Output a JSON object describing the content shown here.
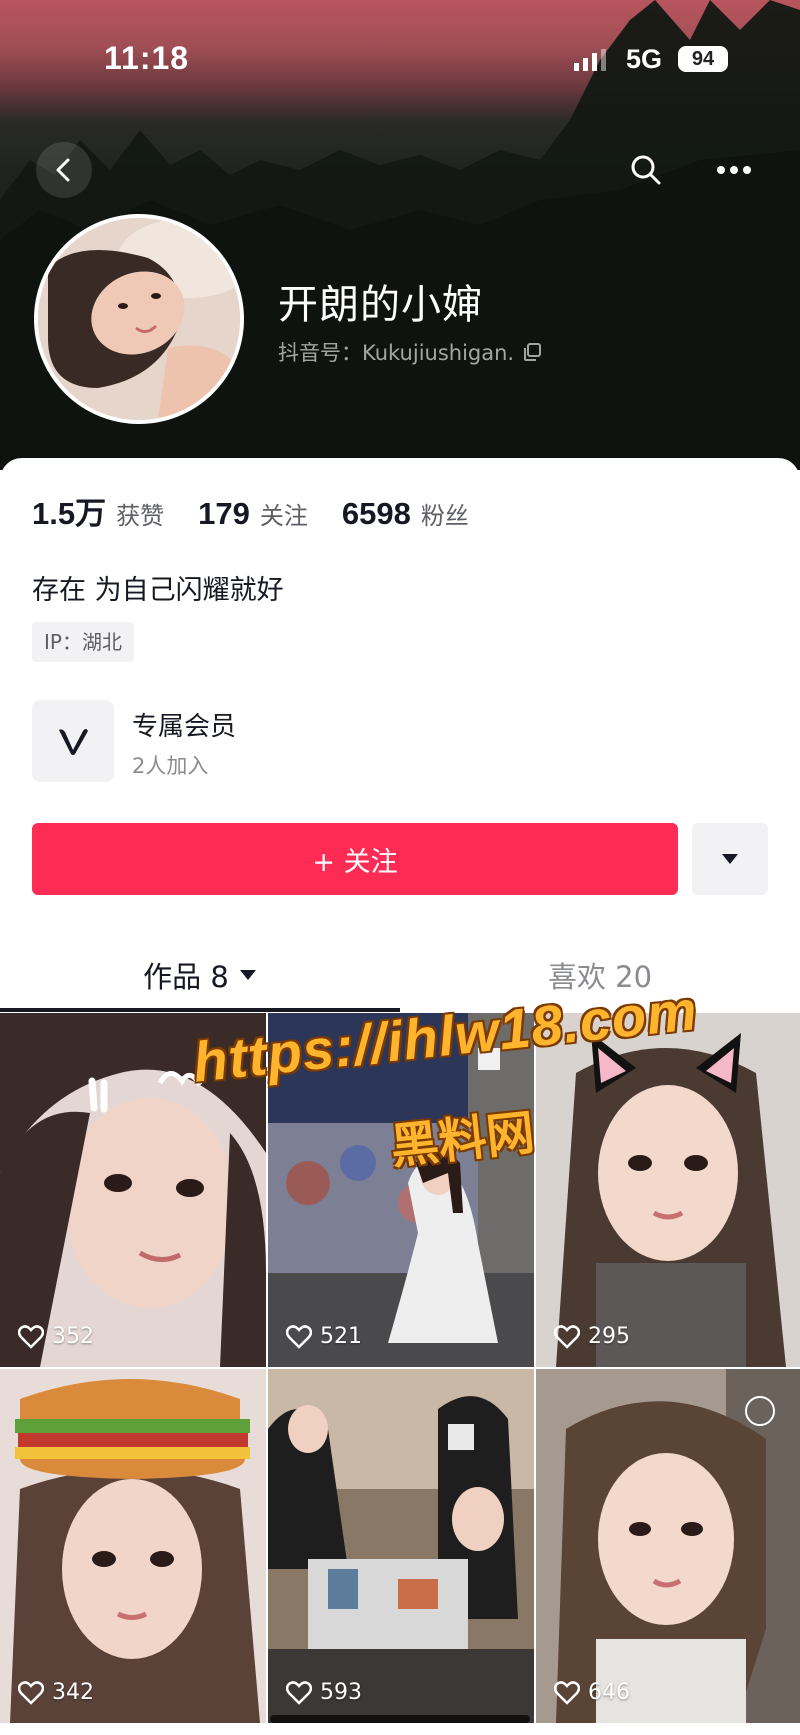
{
  "status_bar": {
    "time": "11:18",
    "network": "5G",
    "battery": "94"
  },
  "profile": {
    "nickname": "开朗的小婶",
    "douyin_id": "抖音号：Kukujiushigan.",
    "bio": "存在 为自己闪耀就好",
    "ip": "IP：湖北"
  },
  "stats": [
    {
      "value": "1.5万",
      "label": "获赞"
    },
    {
      "value": "179",
      "label": "关注"
    },
    {
      "value": "6598",
      "label": "粉丝"
    }
  ],
  "member": {
    "title": "专属会员",
    "subtitle": "2人加入"
  },
  "follow_label": "+ 关注",
  "tabs": [
    {
      "label": "作品 8"
    },
    {
      "label": "喜欢 20"
    }
  ],
  "videos": [
    {
      "likes": "352"
    },
    {
      "likes": "521"
    },
    {
      "likes": "295"
    },
    {
      "likes": "342"
    },
    {
      "likes": "593"
    },
    {
      "likes": "646"
    }
  ],
  "watermark": {
    "line1": "https://ihlw18.com",
    "line2": "黑料网"
  },
  "colors": {
    "accent": "#fe2c55",
    "watermark": "#ffb42e"
  },
  "icons": [
    "back-icon",
    "search-icon",
    "more-icon",
    "copy-icon",
    "member-v-icon",
    "dropdown-icon",
    "heart-icon"
  ]
}
